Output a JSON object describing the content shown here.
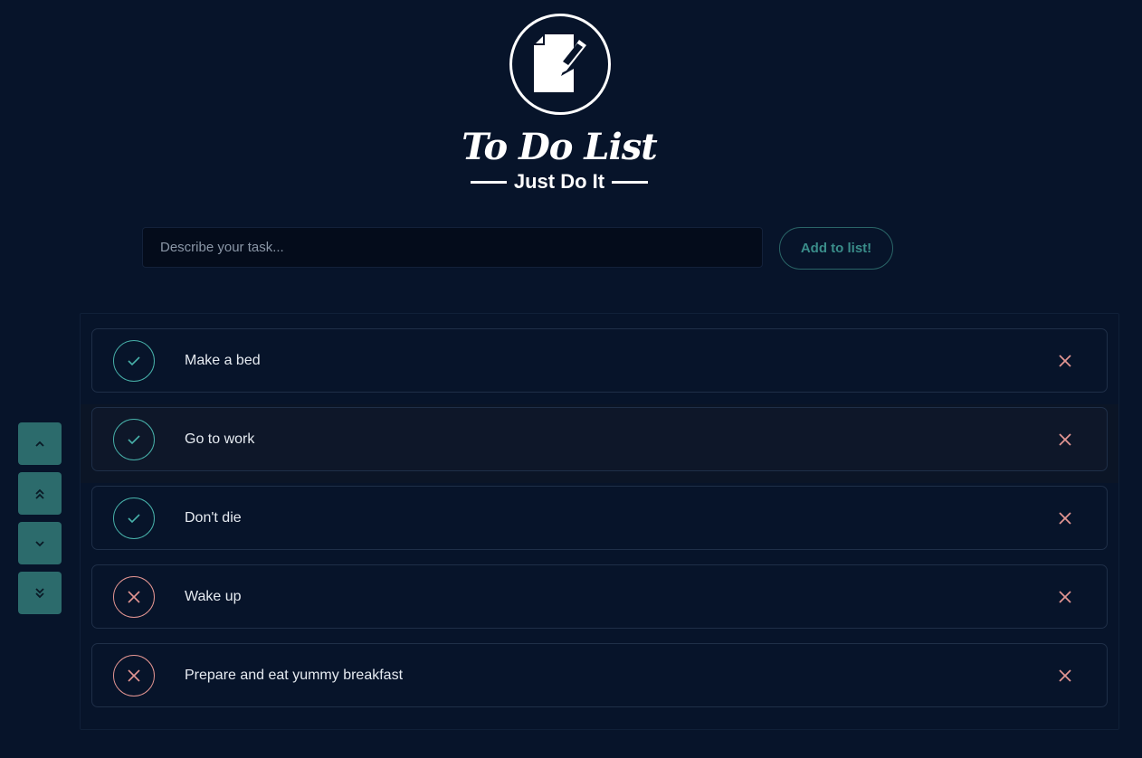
{
  "logo": {
    "title": "To Do List",
    "subtitle": "Just Do It"
  },
  "input": {
    "placeholder": "Describe your task...",
    "value": ""
  },
  "add_button": {
    "label": "Add to list!"
  },
  "side_controls": [
    {
      "icon": "chevron-up-icon"
    },
    {
      "icon": "double-chevron-up-icon"
    },
    {
      "icon": "chevron-down-icon"
    },
    {
      "icon": "double-chevron-down-icon"
    }
  ],
  "tasks": [
    {
      "label": "Make a bed",
      "done": true
    },
    {
      "label": "Go to work",
      "done": true,
      "selected": true
    },
    {
      "label": "Don't die",
      "done": true
    },
    {
      "label": "Wake up",
      "done": false
    },
    {
      "label": "Prepare and eat yummy breakfast",
      "done": false
    }
  ],
  "colors": {
    "background": "#07142a",
    "accent": "#2c6b6c",
    "done": "#47b0a9",
    "not_done": "#e39592"
  }
}
